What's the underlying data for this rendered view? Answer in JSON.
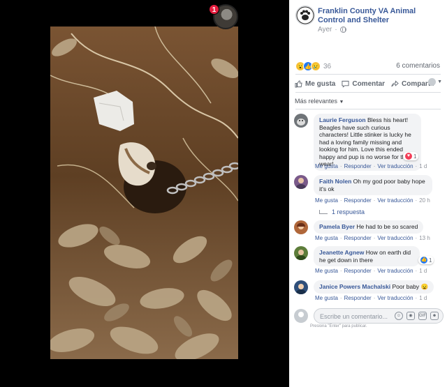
{
  "viewer": {
    "notification_count": "1"
  },
  "post": {
    "page_name": "Franklin County VA Animal Control and Shelter",
    "time": "Ayer",
    "reaction_count": "36",
    "comments_count": "6 comentarios",
    "reactions": [
      "wow-icon",
      "like-icon",
      "sad-icon"
    ]
  },
  "actions": {
    "like": "Me gusta",
    "comment": "Comentar",
    "share": "Compartir"
  },
  "sort": {
    "label": "Más relevantes"
  },
  "comments": [
    {
      "author": "Laurie Ferguson",
      "text": "Bless his heart! Beagles have such curious characters! Little stinker is lucky he had a loving family missing and looking for him. Love this ended happy and pup is no worse for the wear!",
      "like": "Me gusta",
      "reply": "Responder",
      "translate": "Ver traducción",
      "time": "1 d",
      "reaction_count": "1",
      "reaction": "heart-icon"
    },
    {
      "author": "Faith Nolen",
      "text": "Oh my god poor baby hope it's ok",
      "like": "Me gusta",
      "reply": "Responder",
      "translate": "Ver traducción",
      "time": "20 h",
      "replies": "1 respuesta"
    },
    {
      "author": "Pamela Byer",
      "text": "He had to be so scared",
      "like": "Me gusta",
      "reply": "Responder",
      "translate": "Ver traducción",
      "time": "13 h"
    },
    {
      "author": "Jeanette Agnew",
      "text": "How on earth did he get down in there",
      "like": "Me gusta",
      "reply": "Responder",
      "translate": "Ver traducción",
      "time": "1 d",
      "reaction_count": "1",
      "reaction": "like-icon"
    },
    {
      "author": "Janice Powers Machalski",
      "text": "Poor baby",
      "like": "Me gusta",
      "reply": "Responder",
      "translate": "Ver traducción",
      "time": "1 d",
      "emoji": "sad-face-icon"
    }
  ],
  "composer": {
    "placeholder": "Escribe un comentario...",
    "hint": "Presiona \"Enter\" para publicar."
  },
  "colors": {
    "link": "#385898",
    "bubble": "#f2f3f5",
    "like_blue": "#2078f4",
    "heart_red": "#f33e58",
    "notification_red": "#e41e3f"
  }
}
